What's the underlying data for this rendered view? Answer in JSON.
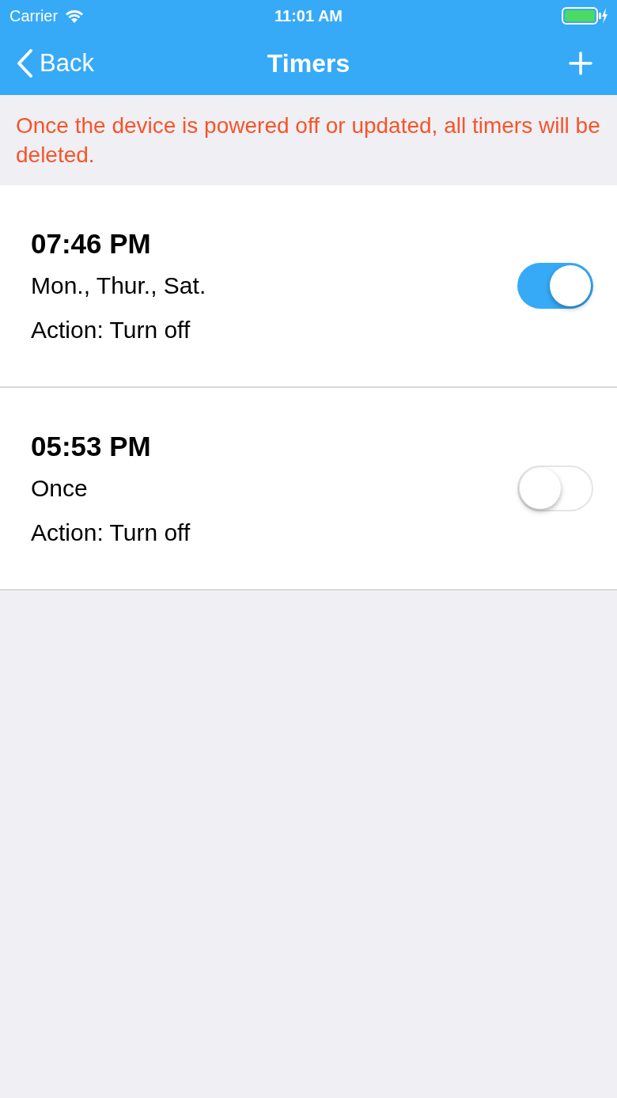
{
  "status_bar": {
    "carrier": "Carrier",
    "time": "11:01 AM"
  },
  "nav": {
    "back": "Back",
    "title": "Timers"
  },
  "notice": "Once the device is powered off or updated, all timers will be deleted.",
  "timers": [
    {
      "time": "07:46 PM",
      "days": "Mon., Thur., Sat.",
      "action": "Action: Turn off",
      "on": true
    },
    {
      "time": "05:53 PM",
      "days": "Once",
      "action": "Action: Turn off",
      "on": false
    }
  ]
}
